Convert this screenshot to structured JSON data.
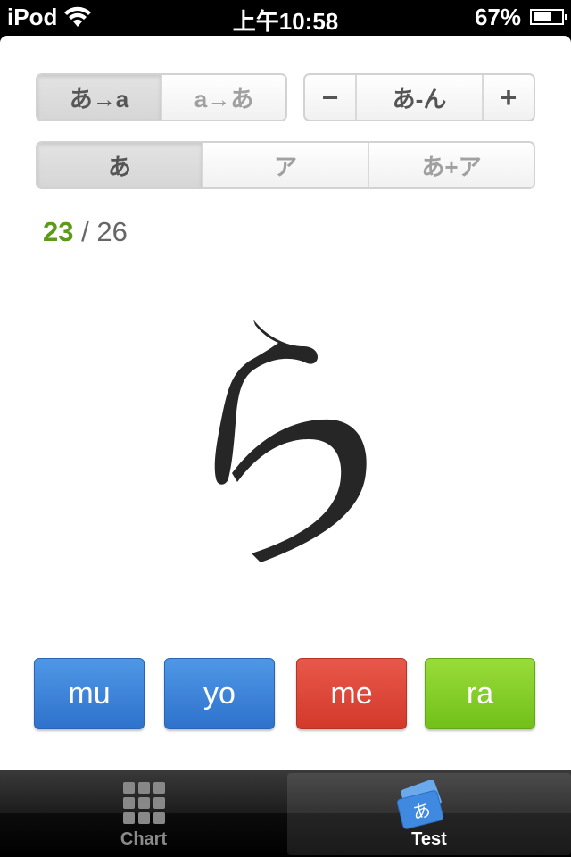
{
  "status_bar": {
    "carrier": "iPod",
    "time": "上午10:58",
    "battery_percent": "67%",
    "battery_level": 0.67
  },
  "mode_segment": {
    "items": [
      "あ→a",
      "a→あ"
    ],
    "selected": 0
  },
  "range_segment": {
    "minus": "−",
    "label": "あ-ん",
    "plus": "+"
  },
  "script_segment": {
    "items": [
      "あ",
      "ア",
      "あ+ア"
    ],
    "selected": 0
  },
  "progress": {
    "current": "23",
    "separator": " / ",
    "total": "26"
  },
  "question": {
    "character": "ら"
  },
  "answers": [
    {
      "label": "mu",
      "color": "blue"
    },
    {
      "label": "yo",
      "color": "blue"
    },
    {
      "label": "me",
      "color": "red"
    },
    {
      "label": "ra",
      "color": "green"
    }
  ],
  "tab_bar": {
    "tabs": [
      {
        "label": "Chart",
        "icon": "grid-icon",
        "selected": false
      },
      {
        "label": "Test",
        "icon": "flashcard-icon",
        "selected": true
      }
    ]
  },
  "colors": {
    "progress_current": "#5c9a1a",
    "answer_blue": "#3a82d8",
    "answer_red": "#de4637",
    "answer_green": "#86ce2a"
  }
}
